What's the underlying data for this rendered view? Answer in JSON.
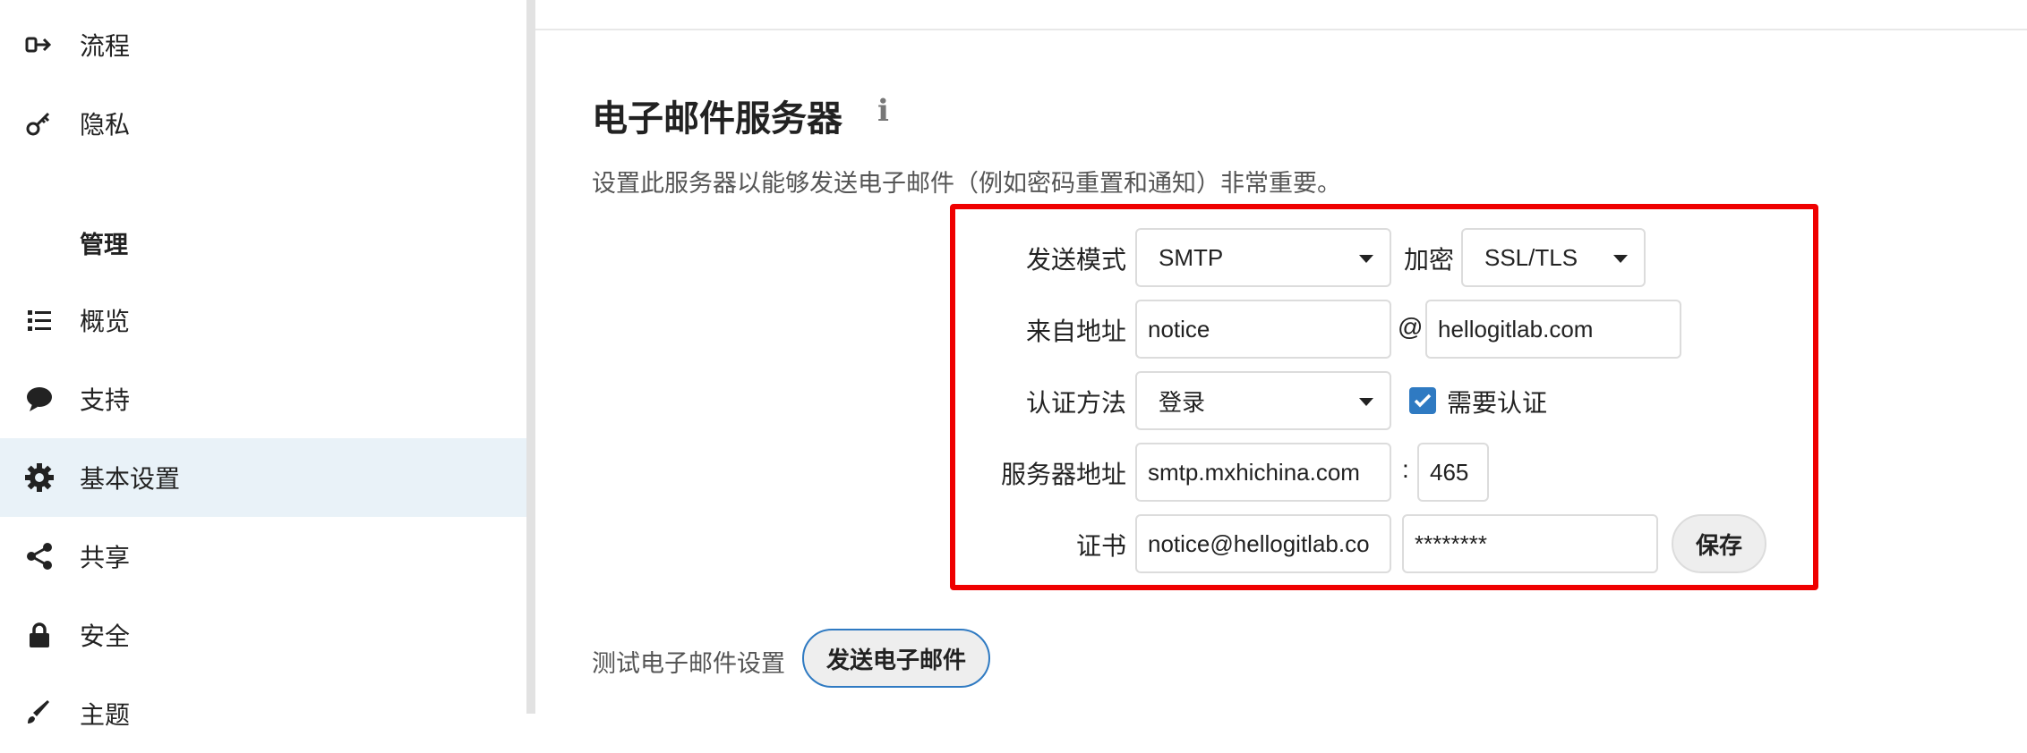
{
  "sidebar": {
    "items": [
      {
        "label": "流程",
        "icon": "flow-icon"
      },
      {
        "label": "隐私",
        "icon": "key-icon"
      },
      {
        "label": "概览",
        "icon": "list-icon"
      },
      {
        "label": "支持",
        "icon": "chat-bubble-icon"
      },
      {
        "label": "基本设置",
        "icon": "gear-icon",
        "active": true
      },
      {
        "label": "共享",
        "icon": "share-icon"
      },
      {
        "label": "安全",
        "icon": "lock-icon"
      },
      {
        "label": "主题",
        "icon": "brush-icon"
      }
    ],
    "section_admin": "管理"
  },
  "main": {
    "title": "电子邮件服务器",
    "info_glyph": "i",
    "description": "设置此服务器以能够发送电子邮件（例如密码重置和通知）非常重要。"
  },
  "form": {
    "send_mode_label": "发送模式",
    "send_mode_value": "SMTP",
    "encryption_label": "加密",
    "encryption_value": "SSL/TLS",
    "from_label": "来自地址",
    "from_local": "notice",
    "at_symbol": "@",
    "from_domain": "hellogitlab.com",
    "auth_method_label": "认证方法",
    "auth_method_value": "登录",
    "require_auth_label": "需要认证",
    "require_auth_checked": true,
    "server_label": "服务器地址",
    "server_host": "smtp.mxhichina.com",
    "colon": ":",
    "server_port": "465",
    "credentials_label": "证书",
    "username": "notice@hellogitlab.co",
    "password": "********",
    "save_button": "保存"
  },
  "test": {
    "label": "测试电子邮件设置",
    "send_button": "发送电子邮件"
  },
  "colors": {
    "highlight_box": "#ef0000",
    "active_bg": "#e9f2f8",
    "checkbox": "#2f7ac2",
    "send_button_border": "#2f7ac2"
  }
}
